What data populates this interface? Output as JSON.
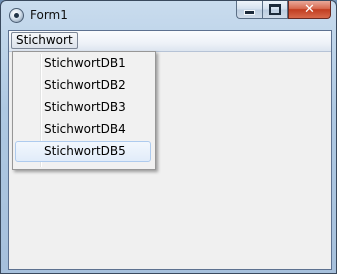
{
  "window": {
    "title": "Form1"
  },
  "caption_buttons": {
    "close_glyph": "✕"
  },
  "menubar": {
    "label": "Stichwort"
  },
  "dropdown": {
    "items": [
      "StichwortDB1",
      "StichwortDB2",
      "StichwortDB3",
      "StichwortDB4",
      "StichwortDB5"
    ],
    "selected_label": "StichwortDB5"
  }
}
